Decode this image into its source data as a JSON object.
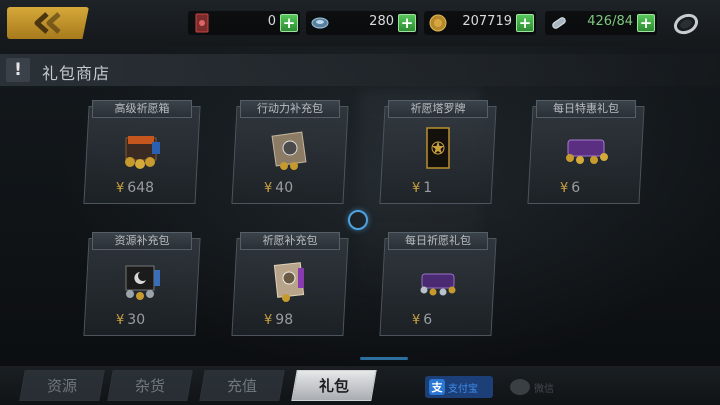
{
  "topbar": {
    "back_icon": "chevron-left-icon",
    "resources": [
      {
        "name": "card-icon",
        "value": "0"
      },
      {
        "name": "crystal-icon",
        "value": "280"
      },
      {
        "name": "coin-icon",
        "value": "207719"
      },
      {
        "name": "stamina-icon",
        "value": "426/84"
      }
    ],
    "plus_label": "+",
    "settings_icon": "settings-ring-icon"
  },
  "section": {
    "icon_label": "!",
    "title": "礼包商店"
  },
  "packs": [
    {
      "title": "高级祈愿箱",
      "currency": "¥",
      "price": "648",
      "art_icon": "chest-icon"
    },
    {
      "title": "行动力补充包",
      "currency": "¥",
      "price": "40",
      "art_icon": "tablet-pack-icon"
    },
    {
      "title": "祈愿塔罗牌",
      "currency": "¥",
      "price": "1",
      "art_icon": "tarot-card-icon"
    },
    {
      "title": "每日特惠礼包",
      "currency": "¥",
      "price": "6",
      "art_icon": "purple-box-icon"
    },
    {
      "title": "资源补充包",
      "currency": "¥",
      "price": "30",
      "art_icon": "resource-pack-icon"
    },
    {
      "title": "祈愿补充包",
      "currency": "¥",
      "price": "98",
      "art_icon": "wish-pack-icon"
    },
    {
      "title": "每日祈愿礼包",
      "currency": "¥",
      "price": "6",
      "art_icon": "daily-box-icon"
    }
  ],
  "tabs": [
    {
      "label": "资源",
      "active": false
    },
    {
      "label": "杂货",
      "active": false
    },
    {
      "label": "充值",
      "active": false
    },
    {
      "label": "礼包",
      "active": true
    }
  ],
  "payments": {
    "alipay_logo": "支",
    "alipay_text": "支付宝",
    "wechat_text": "微信"
  },
  "colors": {
    "accent_gold": "#d6a93a",
    "plus_green": "#3aa83f",
    "spinner_blue": "#4ea4e0",
    "alipay_blue": "#2a78d4"
  }
}
